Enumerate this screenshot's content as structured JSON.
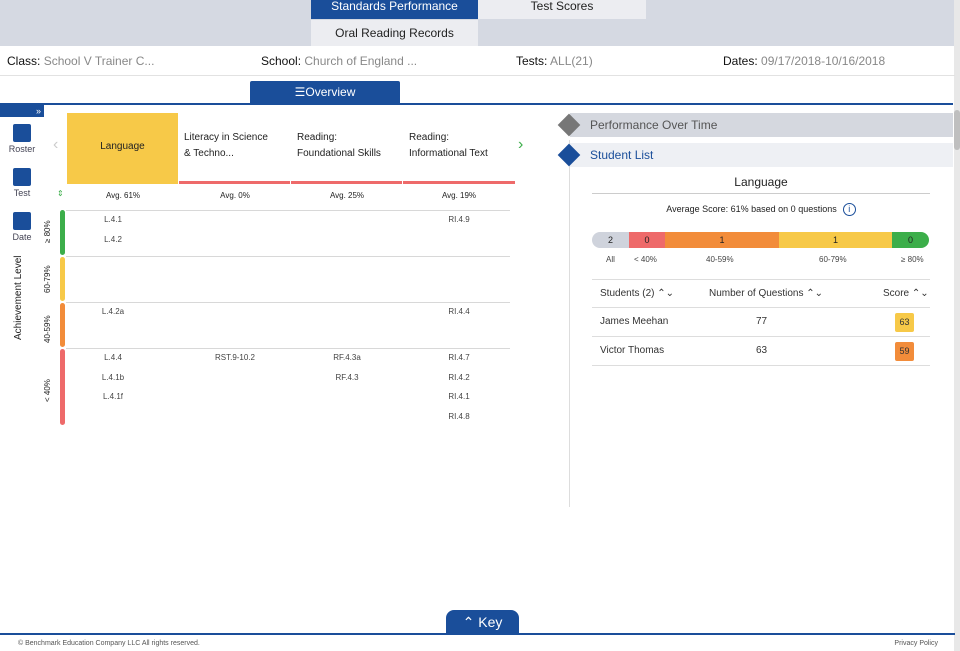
{
  "tabs": {
    "standards_performance": "Standards Performance",
    "test_scores": "Test Scores",
    "oral_reading_records": "Oral Reading Records"
  },
  "filters": {
    "class_label": "Class:",
    "class_value": "School V Trainer C...",
    "school_label": "School:",
    "school_value": "Church of England ...",
    "tests_label": "Tests:",
    "tests_value": "ALL(21)",
    "dates_label": "Dates:",
    "dates_value": "09/17/2018-10/16/2018"
  },
  "overview_tab": "Overview",
  "sidebar": {
    "expand": "»",
    "items": [
      {
        "label": "Roster",
        "icon": "roster-icon"
      },
      {
        "label": "Test",
        "icon": "test-icon"
      },
      {
        "label": "Date",
        "icon": "calendar-icon"
      }
    ]
  },
  "achievement_level_label": "Achievement Level",
  "bands": [
    {
      "label": "≥ 80%",
      "color": "#3cae4a"
    },
    {
      "label": "60-79%",
      "color": "#f7c948"
    },
    {
      "label": "40-59%",
      "color": "#f28c3a"
    },
    {
      "label": "< 40%",
      "color": "#ee6a6a"
    }
  ],
  "columns": [
    {
      "header_line1": "Language",
      "header_line2": "",
      "avg": "Avg. 61%",
      "bar_color": "#f7c948",
      "standards": {
        "ge80": [
          "L.4.1",
          "L.4.2"
        ],
        "60_79": [],
        "40_59": [
          "L.4.2a"
        ],
        "lt40": [
          "L.4.4",
          "L.4.1b",
          "L.4.1f"
        ]
      }
    },
    {
      "header_line1": "Literacy in Science",
      "header_line2": "& Techno...",
      "avg": "Avg. 0%",
      "bar_color": "#ee6a6a",
      "standards": {
        "ge80": [],
        "60_79": [],
        "40_59": [],
        "lt40": [
          "RST.9-10.2"
        ]
      }
    },
    {
      "header_line1": "Reading:",
      "header_line2": "Foundational Skills",
      "avg": "Avg. 25%",
      "bar_color": "#ee6a6a",
      "standards": {
        "ge80": [],
        "60_79": [],
        "40_59": [],
        "lt40": [
          "RF.4.3a",
          "RF.4.3"
        ]
      }
    },
    {
      "header_line1": "Reading:",
      "header_line2": "Informational Text",
      "avg": "Avg. 19%",
      "bar_color": "#ee6a6a",
      "standards": {
        "ge80": [
          "RI.4.9"
        ],
        "60_79": [],
        "40_59": [
          "RI.4.4"
        ],
        "lt40": [
          "RI.4.7",
          "RI.4.2",
          "RI.4.1",
          "RI.4.8"
        ]
      }
    }
  ],
  "right_panel": {
    "performance_over_time": "Performance Over Time",
    "student_list": "Student List",
    "selected_domain": "Language",
    "average_score_text": "Average Score: 61% based on 0 questions",
    "distribution": [
      {
        "count": "2",
        "label": "All",
        "color": "#cfd3dc"
      },
      {
        "count": "0",
        "label": "< 40%",
        "color": "#ee6a6a"
      },
      {
        "count": "1",
        "label": "40-59%",
        "color": "#f28c3a"
      },
      {
        "count": "1",
        "label": "60-79%",
        "color": "#f7c948"
      },
      {
        "count": "0",
        "label": "≥ 80%",
        "color": "#3cae4a"
      }
    ],
    "table_headers": {
      "students": "Students (2) ⌃⌄",
      "questions": "Number of Questions ⌃⌄",
      "score": "Score ⌃⌄"
    },
    "students": [
      {
        "name": "James Meehan",
        "questions": "77",
        "score": "63",
        "score_color": "#f7c948"
      },
      {
        "name": "Victor Thomas",
        "questions": "63",
        "score": "59",
        "score_color": "#f28c3a"
      }
    ]
  },
  "key_button": "Key",
  "footer": {
    "copyright": "© Benchmark Education Company LLC All rights reserved.",
    "privacy": "Privacy Policy"
  }
}
